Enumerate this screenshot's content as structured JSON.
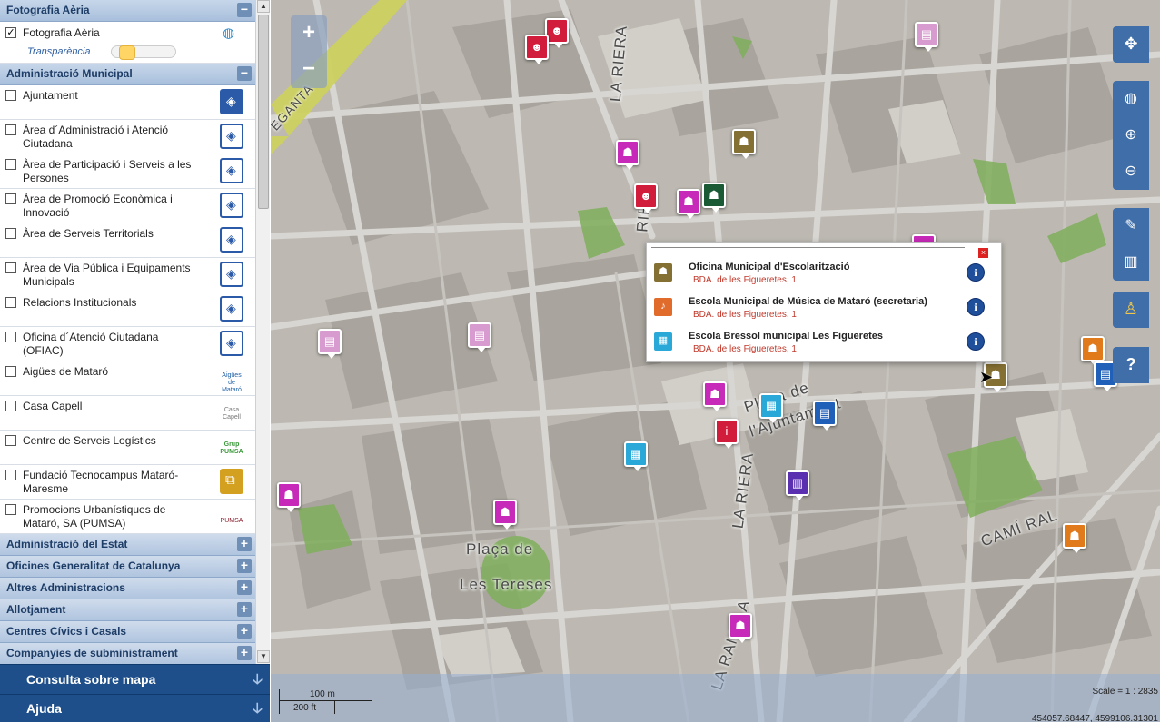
{
  "sidebar": {
    "photo_group": {
      "title": "Fotografia Aèria",
      "toggle": "−",
      "layer_label": "Fotografia Aèria",
      "checked": true,
      "checkmark": "✓",
      "transparency_label": "Transparència",
      "transparency_value": 0.15,
      "icon": "globe-icon"
    },
    "admin_group": {
      "title": "Administració Municipal",
      "toggle": "−",
      "layers": [
        {
          "label": "Ajuntament",
          "icon": "shield-icon-solid"
        },
        {
          "label": "Àrea d´Administració i Atenció Ciutadana",
          "icon": "shield-icon"
        },
        {
          "label": "Àrea de Participació i Serveis a les Persones",
          "icon": "shield-icon"
        },
        {
          "label": "Àrea de Promoció Econòmica i Innovació",
          "icon": "shield-icon"
        },
        {
          "label": "Àrea de Serveis Territorials",
          "icon": "shield-icon"
        },
        {
          "label": "Àrea de Via Pública i Equipaments Municipals",
          "icon": "shield-icon"
        },
        {
          "label": "Relacions Institucionals",
          "icon": "shield-icon"
        },
        {
          "label": "Oficina d´Atenció Ciutadana (OFIAC)",
          "icon": "shield-icon"
        },
        {
          "label": "Aigües de Mataró",
          "icon": "aigues-logo"
        },
        {
          "label": "Casa Capell",
          "icon": "casa-capell-logo"
        },
        {
          "label": "Centre de Serveis Logístics",
          "icon": "grup-pumsa-logo"
        },
        {
          "label": "Fundació Tecnocampus Mataró-Maresme",
          "icon": "tecnocampus-icon"
        },
        {
          "label": "Promocions Urbanístiques de Mataró, SA (PUMSA)",
          "icon": "pumsa-logo"
        }
      ]
    },
    "collapsed_groups": [
      "Administració del Estat",
      "Oficines Generalitat de Catalunya",
      "Altres Administracions",
      "Allotjament",
      "Centres Cívics i Casals",
      "Companyies de subministrament"
    ],
    "expand_symbol": "+",
    "logo_text": {
      "aigues": "Aigües de Mataró",
      "casa_capell": "Casa Capell",
      "grup_pumsa": "Grup PUMSA",
      "pumsa": "PUMSA"
    },
    "accordion": [
      {
        "label": "Consulta sobre mapa",
        "arrow": "🡣"
      },
      {
        "label": "Ajuda",
        "arrow": "🡣"
      }
    ],
    "scroll_up": "▲",
    "scroll_down": "▼"
  },
  "map": {
    "zoom_in": "+",
    "zoom_out": "−",
    "street_labels": {
      "riera_top": "LA RIERA",
      "riera_mid": "LA RIERA",
      "rambla": "LA RAMBLA",
      "cami_ral": "CAMÍ RAL",
      "pl_tereses_1": "Plaça de",
      "pl_tereses_2": "Les Tereses",
      "pl_ajuntament_1": "Plaça de",
      "pl_ajuntament_2": "l'Ajuntament",
      "riera_fragment": "RIE",
      "elegant": "EGANTA"
    },
    "tools": {
      "pan": "✥",
      "globe": "◍",
      "zoom_in": "⊕",
      "zoom_out": "⊖",
      "draw": "✎",
      "layers": "▥",
      "street_view": "♙",
      "help": "?"
    },
    "popup": {
      "close": "×",
      "info": "i",
      "items": [
        {
          "title": "Oficina Municipal d'Escolarització",
          "address": "BDA. de les Figueretes, 1",
          "color": "#857033",
          "glyph": "☗"
        },
        {
          "title": "Escola Municipal de Música de Mataró (secretaria)",
          "address": "BDA. de les Figueretes, 1",
          "color": "#e06b2a",
          "glyph": "♪"
        },
        {
          "title": "Escola Bressol municipal Les Figueretes",
          "address": "BDA. de les Figueretes, 1",
          "color": "#2aa8d8",
          "glyph": "▦"
        }
      ]
    },
    "markers": [
      {
        "color": "red",
        "glyph": "☻"
      },
      {
        "color": "red",
        "glyph": "☻"
      },
      {
        "color": "lightpink",
        "glyph": "▤"
      },
      {
        "color": "pink",
        "glyph": "☗"
      },
      {
        "color": "olive",
        "glyph": "☗"
      },
      {
        "color": "red",
        "glyph": "☻"
      },
      {
        "color": "pink",
        "glyph": "☗"
      },
      {
        "color": "green",
        "glyph": "☗"
      },
      {
        "color": "pink",
        "glyph": "☗"
      },
      {
        "color": "lightpink",
        "glyph": "▤"
      },
      {
        "color": "lightpink",
        "glyph": "▤"
      },
      {
        "color": "pink",
        "glyph": "☗"
      },
      {
        "color": "cyan",
        "glyph": "▦"
      },
      {
        "color": "blue",
        "glyph": "▤"
      },
      {
        "color": "red",
        "glyph": "i"
      },
      {
        "color": "cyan",
        "glyph": "▦"
      },
      {
        "color": "purple",
        "glyph": "▥"
      },
      {
        "color": "pink",
        "glyph": "☗"
      },
      {
        "color": "pink",
        "glyph": "☗"
      },
      {
        "color": "pink",
        "glyph": "☗"
      },
      {
        "color": "olive",
        "glyph": "☗"
      },
      {
        "color": "orange",
        "glyph": "☗"
      },
      {
        "color": "blue",
        "glyph": "▤"
      },
      {
        "color": "orange",
        "glyph": "☗"
      }
    ],
    "scale": {
      "metric": "100 m",
      "imperial": "200 ft",
      "ratio": "Scale = 1 : 2835",
      "coords": "454057.68447, 4599106.31301"
    }
  }
}
